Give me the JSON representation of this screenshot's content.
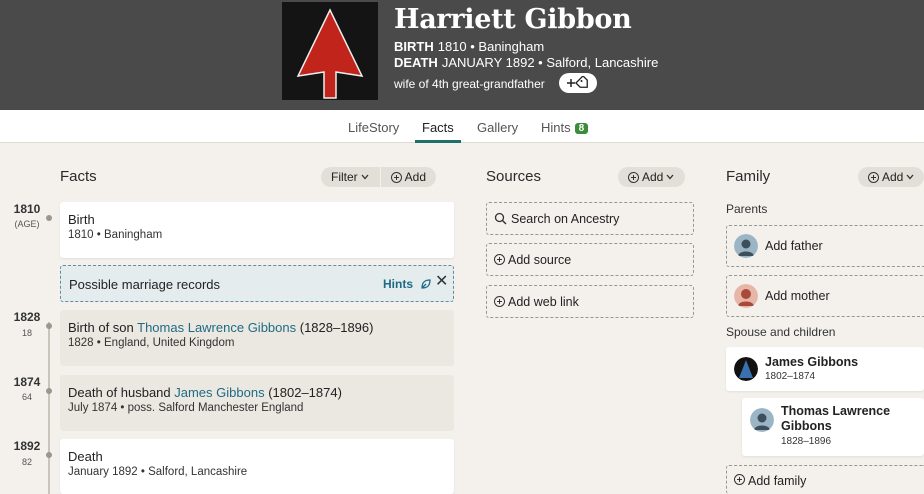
{
  "person": {
    "name": "Harriett Gibbon",
    "birth_label": "BIRTH",
    "birth_value": "1810 • Baningham",
    "death_label": "DEATH",
    "death_value": "JANUARY 1892 • Salford, Lancashire",
    "relation": "wife of 4th great-grandfather"
  },
  "tabs": [
    {
      "label": "LifeStory"
    },
    {
      "label": "Facts"
    },
    {
      "label": "Gallery"
    },
    {
      "label": "Hints",
      "badge": "8"
    }
  ],
  "facts": {
    "title": "Facts",
    "filter_label": "Filter",
    "add_label": "Add",
    "timeline": [
      {
        "year": "1810",
        "age": "(AGE)"
      },
      {
        "year": "1828",
        "age": "18"
      },
      {
        "year": "1874",
        "age": "64"
      },
      {
        "year": "1892",
        "age": "82"
      }
    ],
    "birth": {
      "title": "Birth",
      "sub": "1810 • Baningham"
    },
    "hint": {
      "text": "Possible marriage records",
      "link": "Hints"
    },
    "son": {
      "prefix": "Birth of son ",
      "name": "Thomas Lawrence Gibbons",
      "years": " (1828–1896)",
      "sub": "1828 • England, United Kingdom"
    },
    "husband": {
      "prefix": "Death of husband ",
      "name": "James Gibbons",
      "years": " (1802–1874)",
      "sub": "July 1874 • poss. Salford Manchester England"
    },
    "death": {
      "title": "Death",
      "sub": "January 1892 • Salford, Lancashire"
    }
  },
  "sources": {
    "title": "Sources",
    "add_label": "Add",
    "search": "Search on Ancestry",
    "add_source": "Add source",
    "add_web_link": "Add web link"
  },
  "family": {
    "title": "Family",
    "add_label": "Add",
    "parents_label": "Parents",
    "add_father": "Add father",
    "add_mother": "Add mother",
    "spouse_label": "Spouse and children",
    "spouse": {
      "name": "James Gibbons",
      "dates": "1802–1874"
    },
    "child": {
      "name_line1": "Thomas Lawrence",
      "name_line2": "Gibbons",
      "dates": "1828–1896"
    },
    "add_family": "Add family"
  },
  "colors": {
    "header_bg": "#4a4a4a",
    "accent": "#1e6e69",
    "link": "#1f6b85",
    "badge": "#3c8c3c",
    "arrow_red": "#c0241a"
  }
}
